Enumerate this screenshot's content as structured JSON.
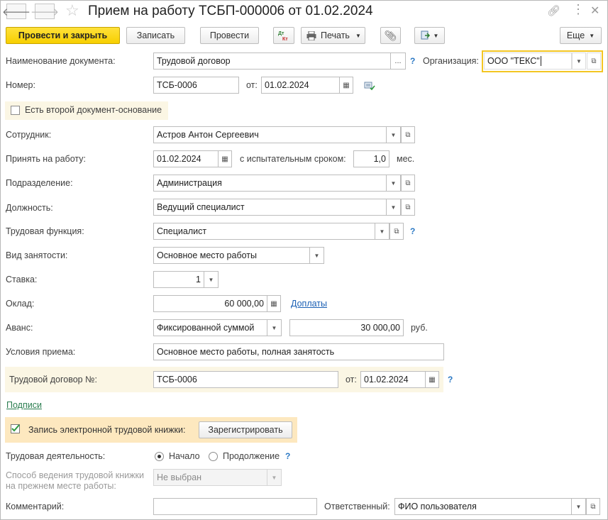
{
  "window": {
    "title": "Прием на работу ТСБП-000006 от 01.02.2024"
  },
  "toolbar": {
    "post_close": "Провести и закрыть",
    "save": "Записать",
    "post": "Провести",
    "dtkt": "Дт Кт",
    "print": "Печать",
    "more": "Еще"
  },
  "form": {
    "doc_name_label": "Наименование документа:",
    "doc_name_value": "Трудовой договор",
    "doc_name_btn": "...",
    "org_label": "Организация:",
    "org_value": "ООО \"ТЕКС\"",
    "number_label": "Номер:",
    "number_value": "ТСБ-0006",
    "from_label": "от:",
    "date_value": "01.02.2024",
    "second_doc_label": "Есть второй документ-основание",
    "employee_label": "Сотрудник:",
    "employee_value": "Астров Антон Сергеевич",
    "hire_label": "Принять на работу:",
    "hire_date": "01.02.2024",
    "probation_label": "с испытательным сроком:",
    "probation_value": "1,0",
    "probation_unit": "мес.",
    "dept_label": "Подразделение:",
    "dept_value": "Администрация",
    "position_label": "Должность:",
    "position_value": "Ведущий специалист",
    "function_label": "Трудовая функция:",
    "function_value": "Специалист",
    "employment_label": "Вид занятости:",
    "employment_value": "Основное место работы",
    "rate_label": "Ставка:",
    "rate_value": "1",
    "salary_label": "Оклад:",
    "salary_value": "60 000,00",
    "allowances_link": "Доплаты",
    "advance_label": "Аванс:",
    "advance_type": "Фиксированной суммой",
    "advance_value": "30 000,00",
    "advance_unit": "руб.",
    "conditions_label": "Условия приема:",
    "conditions_value": "Основное место работы, полная занятость",
    "contract_label": "Трудовой договор №:",
    "contract_value": "ТСБ-0006",
    "contract_from_label": "от:",
    "contract_date": "01.02.2024",
    "signatures_link": "Подписи",
    "etk_label": "Запись электронной трудовой книжки:",
    "register_btn": "Зарегистрировать",
    "activity_label": "Трудовая деятельность:",
    "radio_start": "Начало",
    "radio_continue": "Продолжение",
    "book_method_label_1": "Способ ведения трудовой книжки",
    "book_method_label_2": "на прежнем месте работы:",
    "book_method_value": "Не выбран",
    "comment_label": "Комментарий:",
    "comment_value": "",
    "responsible_label": "Ответственный:",
    "responsible_value": "ФИО пользователя"
  },
  "colors": {
    "accent_yellow": "#f7cf00",
    "link_blue": "#1a5fb4",
    "link_green": "#2a7d4f",
    "help_blue": "#2a78c4",
    "org_highlight": "#f3c623"
  }
}
